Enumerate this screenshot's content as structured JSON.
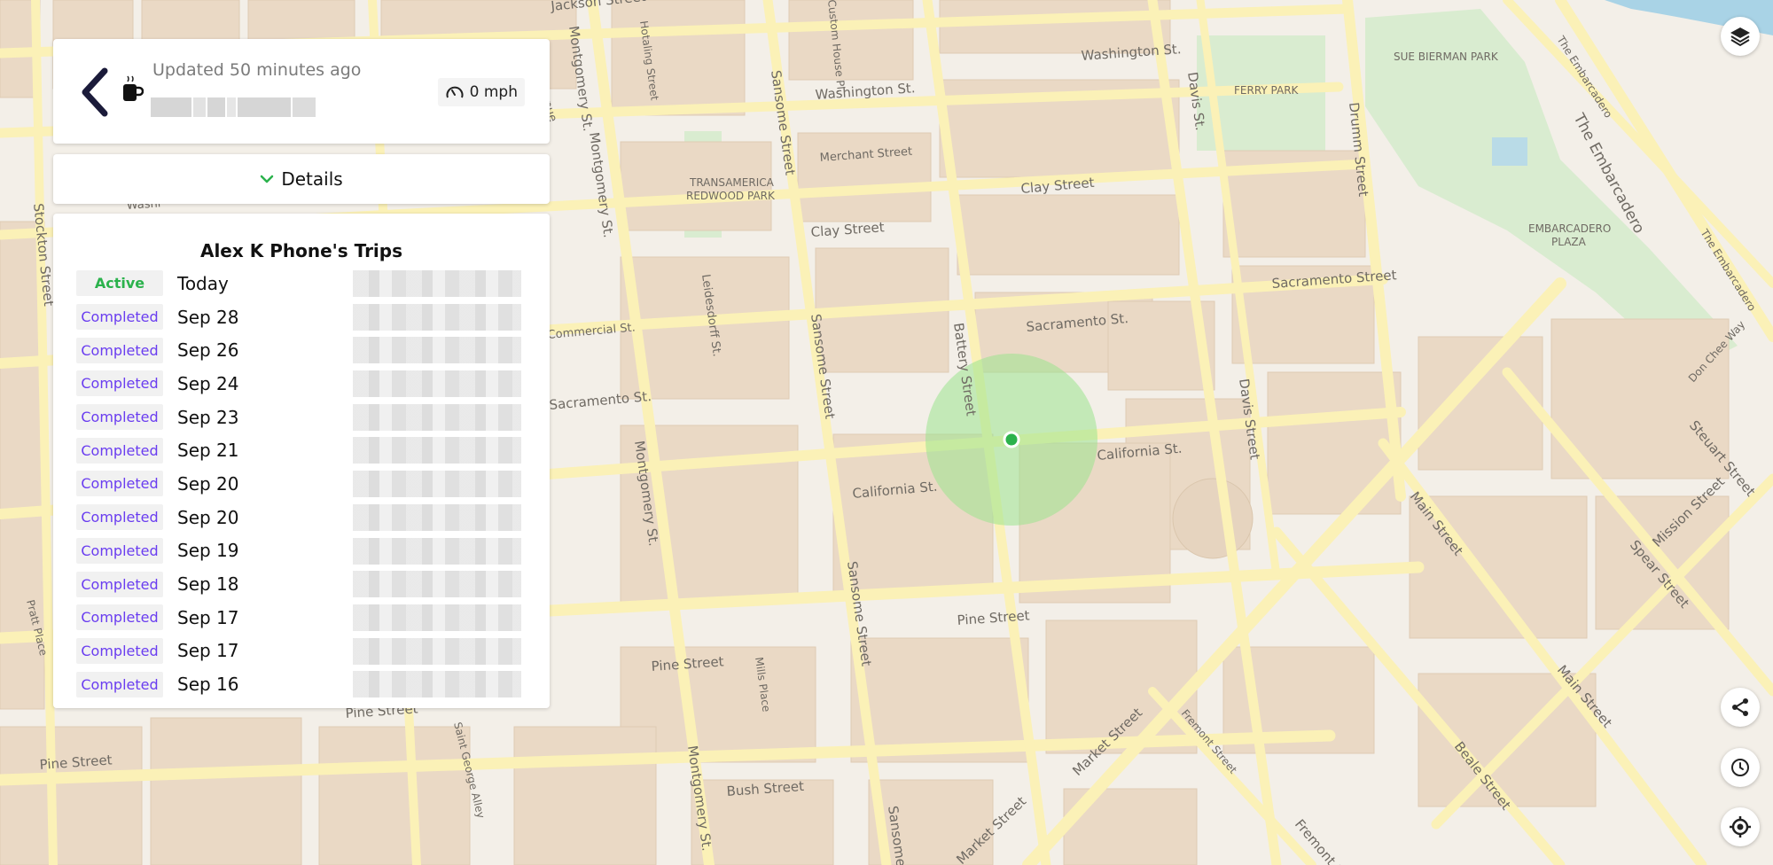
{
  "header": {
    "updated_text": "Updated 50 minutes ago",
    "speed_text": "0 mph"
  },
  "details": {
    "label": "Details"
  },
  "trips": {
    "title": "Alex K Phone's Trips",
    "items": [
      {
        "status": "Active",
        "date": "Today"
      },
      {
        "status": "Completed",
        "date": "Sep 28"
      },
      {
        "status": "Completed",
        "date": "Sep 26"
      },
      {
        "status": "Completed",
        "date": "Sep 24"
      },
      {
        "status": "Completed",
        "date": "Sep 23"
      },
      {
        "status": "Completed",
        "date": "Sep 21"
      },
      {
        "status": "Completed",
        "date": "Sep 20"
      },
      {
        "status": "Completed",
        "date": "Sep 20"
      },
      {
        "status": "Completed",
        "date": "Sep 19"
      },
      {
        "status": "Completed",
        "date": "Sep 18"
      },
      {
        "status": "Completed",
        "date": "Sep 17"
      },
      {
        "status": "Completed",
        "date": "Sep 17"
      },
      {
        "status": "Completed",
        "date": "Sep 16"
      }
    ]
  },
  "map_labels": {
    "washington_1": "Washington St.",
    "washington_2": "Washington St.",
    "clay_1": "Clay Street",
    "clay_2": "Clay Street",
    "sacramento_1": "Sacramento St.",
    "sacramento_2": "Sacramento Street",
    "sacramento_3": "Sacramento St.",
    "california_1": "California St.",
    "california_2": "California St.",
    "pine_1": "Pine Street",
    "pine_2": "Pine Street",
    "pine_3": "Pine Street",
    "pine_4": "Pine Street",
    "bush": "Bush Street",
    "montgomery_1": "Montgomery St.",
    "montgomery_2": "Montgomery St.",
    "montgomery_3": "Montgomery St.",
    "montgomery_4": "Montgomery St.",
    "sansome_1": "Sansome Street",
    "sansome_2": "Sansome Street",
    "sansome_3": "Sansome Street",
    "sansome_4": "Sansome",
    "battery": "Battery Street",
    "davis_1": "Davis Street",
    "davis_2": "Davis St.",
    "drumm": "Drumm Street",
    "main_1": "Main Street",
    "main_2": "Main Street",
    "spear": "Spear Street",
    "steuart": "Steuart Street",
    "beale": "Beale Street",
    "fremont_1": "Fremont Street",
    "fremont_2": "Fremont Street",
    "market_1": "Market Street",
    "market_2": "Market Street",
    "mission": "Mission Street",
    "embarcadero_1": "The Embarcadero",
    "embarcadero_2": "The Embarcadero",
    "embarcadero_3": "The Embarcadero",
    "don_chee": "Don Chee Way",
    "merchant": "Merchant Street",
    "leidesdorff": "Leidesdorff St.",
    "hotaling": "Hotaling Street",
    "jackson": "Jackson Street",
    "custom_house": "Custom House Pl.",
    "commercial": "Commercial St.",
    "stockton": "Stockton Street",
    "mills": "Mills Place",
    "st_george": "Saint George Alley",
    "pratt": "Pratt Place",
    "washington_left": "Washi",
    "avenue": "venue",
    "sue_bierman": "SUE BIERMAN PARK",
    "ferry_park": "FERRY PARK",
    "transamerica_1": "TRANSAMERICA",
    "transamerica_2": "REDWOOD PARK",
    "embarcadero_plaza_1": "EMBARCADERO",
    "embarcadero_plaza_2": "PLAZA"
  },
  "colors": {
    "status_active": "#2bb24c",
    "status_completed": "#6a3df0",
    "road": "#fbf1b7",
    "building": "#ead9c5",
    "park": "#d9ecd0",
    "water": "#a9d3e6",
    "location_dot": "#2bb24c",
    "accuracy_circle": "#9be38e"
  },
  "icons": {
    "back": "chevron-left-icon",
    "cup": "coffee-cup-icon",
    "speed": "speedometer-icon",
    "details_chevron": "chevron-down-icon",
    "layers": "layers-icon",
    "share": "share-icon",
    "history": "clock-icon",
    "locate": "locate-icon"
  }
}
